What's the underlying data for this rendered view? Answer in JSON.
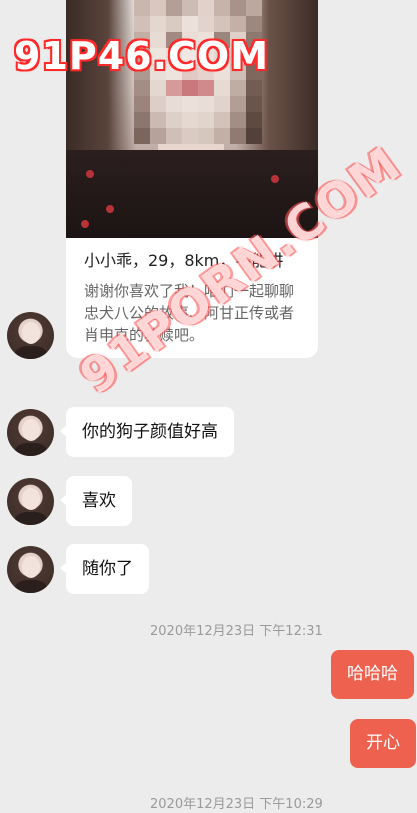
{
  "profile_card": {
    "title": "小小乖，29，8km，不能讲",
    "description": "谢谢你喜欢了我！咱们一起聊聊忠犬八公的故事、阿甘正传或者肖申克的救赎吧。"
  },
  "messages": [
    {
      "side": "left",
      "text": "你的狗子颜值好高"
    },
    {
      "side": "left",
      "text": "喜欢"
    },
    {
      "side": "left",
      "text": "随你了"
    },
    {
      "side": "right",
      "text": "哈哈哈"
    },
    {
      "side": "right",
      "text": "开心"
    }
  ],
  "timestamps": [
    "2020年12月23日 下午12:31",
    "2020年12月23日 下午10:29"
  ],
  "watermarks": {
    "top": "91P46.COM",
    "diagonal": "91PORN.COM"
  },
  "colors": {
    "background": "#ececec",
    "incoming_bubble": "#ffffff",
    "outgoing_bubble": "#ee614e",
    "timestamp": "#9a9a9a"
  }
}
